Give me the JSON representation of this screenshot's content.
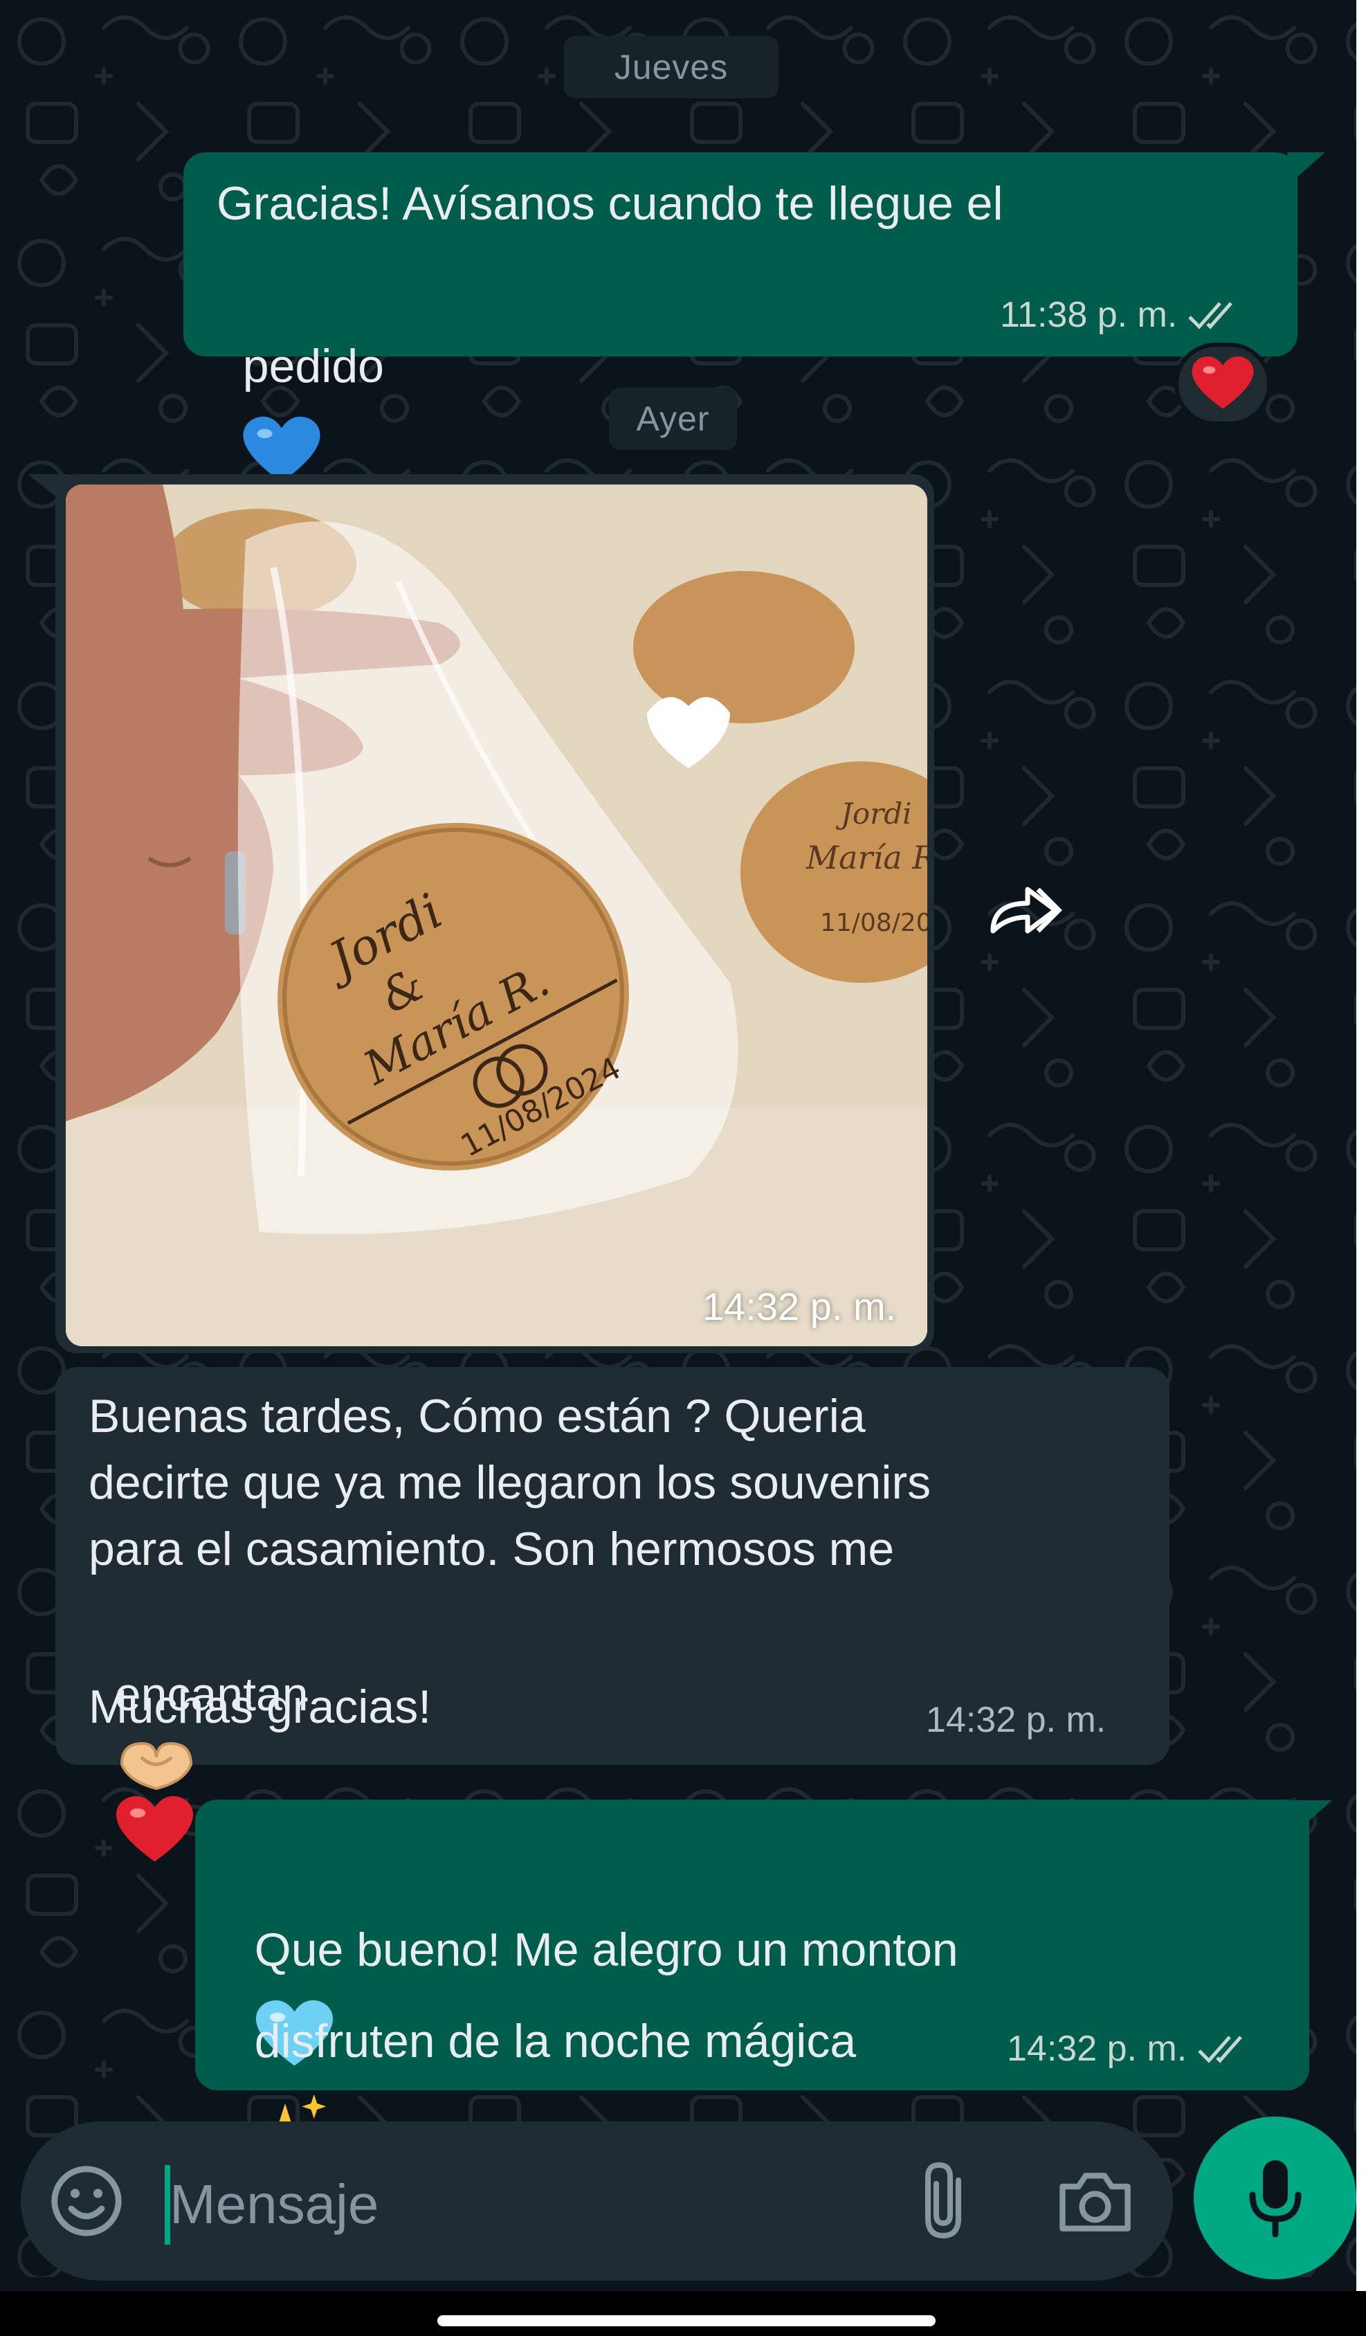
{
  "theme": {
    "background": "#0b141a",
    "outgoing_bubble": "#005c4b",
    "incoming_bubble": "#202c33",
    "accent": "#00a884",
    "reaction_heart": "#e0202e",
    "blue_heart": "#2b8ae0"
  },
  "dates": {
    "first": "Jueves",
    "second": "Ayer"
  },
  "messages": [
    {
      "direction": "outgoing",
      "line1": "Gracias! Avísanos cuando te llegue el",
      "line2": "pedido",
      "emoji": "blue-heart-icon",
      "time": "11:38 p. m.",
      "status": "read-double-check",
      "reaction": "red-heart-icon"
    },
    {
      "direction": "incoming",
      "type": "image",
      "image_text": {
        "names_line1": "Jordi",
        "names_line2": "&",
        "names_line3": "María R.",
        "date": "11/08/2024",
        "side_date": "11/08/20"
      },
      "time": "14:32 p. m."
    },
    {
      "direction": "incoming",
      "line1": "Buenas tardes, Cómo están ? Queria",
      "line2": "decirte que ya me llegaron los souvenirs",
      "line3": "para el casamiento. Son hermosos me",
      "line4": "encantan",
      "line5": "Muchas gracias!",
      "emojis": [
        "heart-hands-icon",
        "red-heart-icon"
      ],
      "time": "14:32 p. m."
    },
    {
      "direction": "outgoing",
      "line1": "Que bueno! Me alegro un monton",
      "line2": "disfruten de la noche mágica",
      "emojis": [
        "light-blue-heart-icon",
        "sparkles-icon"
      ],
      "time": "14:32 p. m.",
      "status": "read-double-check"
    }
  ],
  "composer": {
    "placeholder": "Mensaje",
    "icons": [
      "emoji-icon",
      "paperclip-icon",
      "camera-icon",
      "microphone-icon"
    ]
  }
}
